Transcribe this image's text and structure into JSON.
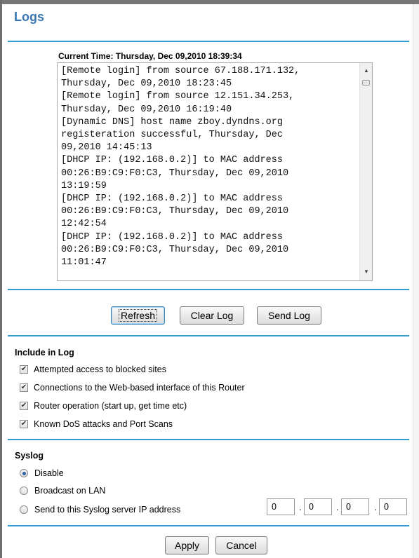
{
  "page": {
    "title": "Logs"
  },
  "current_time": "Current Time: Thursday, Dec 09,2010 18:39:34",
  "log_text": "[Remote login] from source 67.188.171.132,\nThursday, Dec 09,2010 18:23:45\n[Remote login] from source 12.151.34.253,\nThursday, Dec 09,2010 16:19:40\n[Dynamic DNS] host name zboy.dyndns.org\nregisteration successful, Thursday, Dec\n09,2010 14:45:13\n[DHCP IP: (192.168.0.2)] to MAC address\n00:26:B9:C9:F0:C3, Thursday, Dec 09,2010\n13:19:59\n[DHCP IP: (192.168.0.2)] to MAC address\n00:26:B9:C9:F0:C3, Thursday, Dec 09,2010\n12:42:54\n[DHCP IP: (192.168.0.2)] to MAC address\n00:26:B9:C9:F0:C3, Thursday, Dec 09,2010\n11:01:47",
  "buttons": {
    "refresh": "Refresh",
    "clear_log": "Clear Log",
    "send_log": "Send Log"
  },
  "include_in_log": {
    "heading": "Include in Log",
    "items": [
      {
        "label": "Attempted access to blocked sites",
        "checked": true
      },
      {
        "label": "Connections to the Web-based interface of this Router",
        "checked": true
      },
      {
        "label": "Router operation (start up, get time etc)",
        "checked": true
      },
      {
        "label": "Known DoS attacks and Port Scans",
        "checked": true
      }
    ]
  },
  "syslog": {
    "heading": "Syslog",
    "options": [
      {
        "label": "Disable",
        "selected": true
      },
      {
        "label": "Broadcast on LAN",
        "selected": false
      },
      {
        "label": "Send to this Syslog server IP address",
        "selected": false
      }
    ],
    "ip": [
      "0",
      "0",
      "0",
      "0"
    ]
  },
  "footer": {
    "apply": "Apply",
    "cancel": "Cancel"
  },
  "colors": {
    "accent": "#2e9bd1",
    "title": "#3b76b3"
  }
}
